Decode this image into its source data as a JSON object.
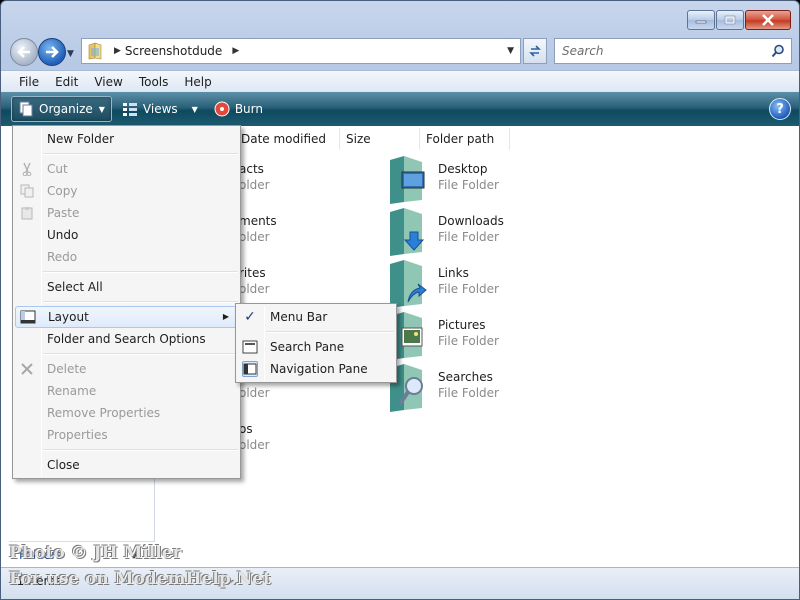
{
  "address": {
    "path": "Screenshotdude"
  },
  "search": {
    "placeholder": "Search"
  },
  "menubar": [
    "File",
    "Edit",
    "View",
    "Tools",
    "Help"
  ],
  "toolbar": {
    "organize": "Organize",
    "views": "Views",
    "burn": "Burn",
    "help": "?"
  },
  "columns": [
    "Date modified",
    "Size",
    "Folder path"
  ],
  "left_files": [
    {
      "name": "acts",
      "type": "older"
    },
    {
      "name": "ments",
      "type": "older"
    },
    {
      "name": "rites",
      "type": "older"
    },
    {
      "name": "",
      "type": ""
    },
    {
      "name": "",
      "type": "older"
    },
    {
      "name": "os",
      "type": "older"
    }
  ],
  "right_files": [
    {
      "name": "Desktop",
      "type": "File Folder",
      "icon": "desktop-folder-icon"
    },
    {
      "name": "Downloads",
      "type": "File Folder",
      "icon": "downloads-folder-icon"
    },
    {
      "name": "Links",
      "type": "File Folder",
      "icon": "links-folder-icon"
    },
    {
      "name": "Pictures",
      "type": "File Folder",
      "icon": "pictures-folder-icon"
    },
    {
      "name": "Searches",
      "type": "File Folder",
      "icon": "searches-folder-icon"
    }
  ],
  "nav_pane": {
    "folders_label": "Folders"
  },
  "status": {
    "items": "11 items"
  },
  "organize_menu": {
    "new_folder": "New Folder",
    "cut": "Cut",
    "copy": "Copy",
    "paste": "Paste",
    "undo": "Undo",
    "redo": "Redo",
    "select_all": "Select All",
    "layout": "Layout",
    "folder_options": "Folder and Search Options",
    "delete": "Delete",
    "rename": "Rename",
    "remove_properties": "Remove Properties",
    "properties": "Properties",
    "close": "Close"
  },
  "layout_menu": {
    "menu_bar": "Menu Bar",
    "search_pane": "Search Pane",
    "navigation_pane": "Navigation Pane"
  },
  "watermark": {
    "line1": "Photo © JH Miller",
    "line2": "For use on ModemHelp.Net"
  },
  "colors": {
    "toolbar": "#1e5a70",
    "accent": "#1d5bbf",
    "close_button": "#c33b22"
  }
}
